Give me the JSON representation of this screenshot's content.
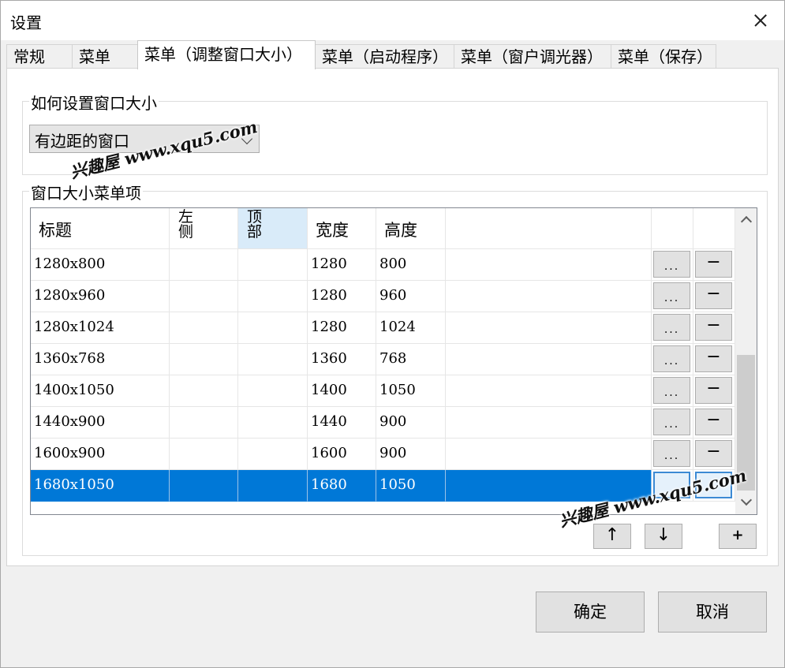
{
  "window": {
    "title": "设置"
  },
  "tabs": [
    {
      "label": "常规"
    },
    {
      "label": "菜单"
    },
    {
      "label": "菜单（调整窗口大小）"
    },
    {
      "label": "菜单（启动程序）"
    },
    {
      "label": "菜单（窗户调光器）"
    },
    {
      "label": "菜单（保存）"
    }
  ],
  "resize_group": {
    "legend": "如何设置窗口大小",
    "combo_value": "有边距的窗口"
  },
  "menu_group": {
    "legend": "窗口大小菜单项",
    "columns": {
      "title": "标题",
      "left": "左侧",
      "top": "顶部",
      "width": "宽度",
      "height": "高度"
    },
    "rows": [
      {
        "title": "1280x800",
        "left": "",
        "top": "",
        "width": "1280",
        "height": "800",
        "edit": "...",
        "remove": "−"
      },
      {
        "title": "1280x960",
        "left": "",
        "top": "",
        "width": "1280",
        "height": "960",
        "edit": "...",
        "remove": "−"
      },
      {
        "title": "1280x1024",
        "left": "",
        "top": "",
        "width": "1280",
        "height": "1024",
        "edit": "...",
        "remove": "−"
      },
      {
        "title": "1360x768",
        "left": "",
        "top": "",
        "width": "1360",
        "height": "768",
        "edit": "...",
        "remove": "−"
      },
      {
        "title": "1400x1050",
        "left": "",
        "top": "",
        "width": "1400",
        "height": "1050",
        "edit": "...",
        "remove": "−"
      },
      {
        "title": "1440x900",
        "left": "",
        "top": "",
        "width": "1440",
        "height": "900",
        "edit": "...",
        "remove": "−"
      },
      {
        "title": "1600x900",
        "left": "",
        "top": "",
        "width": "1600",
        "height": "900",
        "edit": "...",
        "remove": "−"
      },
      {
        "title": "1680x1050",
        "left": "",
        "top": "",
        "width": "1680",
        "height": "1050",
        "edit": "",
        "remove": ""
      }
    ],
    "selected_row": 7,
    "move_up": "↑",
    "move_down": "↓",
    "add": "+"
  },
  "footer": {
    "ok": "确定",
    "cancel": "取消"
  },
  "watermark": "兴趣屋 www.xqu5.com",
  "colors": {
    "selection": "#0078d7",
    "header_selected": "#d9ebf9"
  }
}
